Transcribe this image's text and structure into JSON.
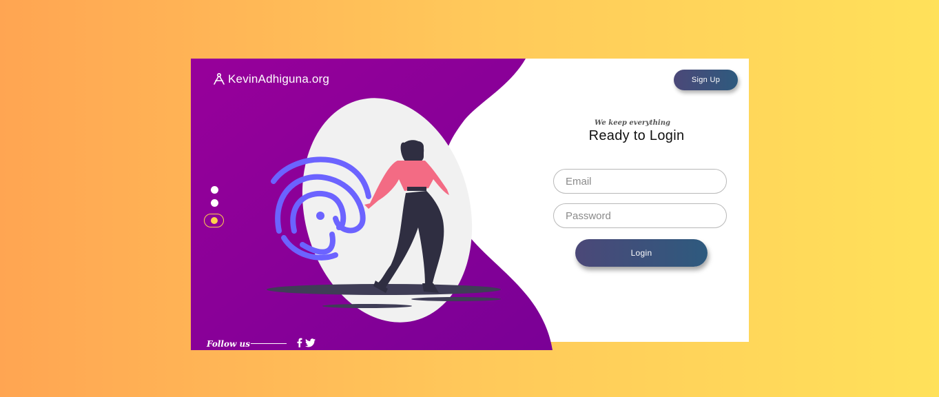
{
  "brand": {
    "name": "KevinAdhiguna.org",
    "icon": "compass-logo-icon"
  },
  "header": {
    "signup_label": "Sign Up"
  },
  "slider": {
    "total": 3,
    "active_index": 3
  },
  "footer": {
    "follow_label": "Follow us",
    "social_icons": [
      "facebook-icon",
      "twitter-icon"
    ]
  },
  "login": {
    "tagline": "We keep everything",
    "title": "Ready to Login",
    "email_placeholder": "Email",
    "password_placeholder": "Password",
    "submit_label": "Login"
  },
  "colors": {
    "purple": "#8e0094",
    "accent_yellow": "#ffd34d",
    "button_gradient_start": "#4b4878",
    "button_gradient_end": "#2e5a7e",
    "fingerprint": "#6c63ff",
    "figure_top": "#f36b84"
  }
}
